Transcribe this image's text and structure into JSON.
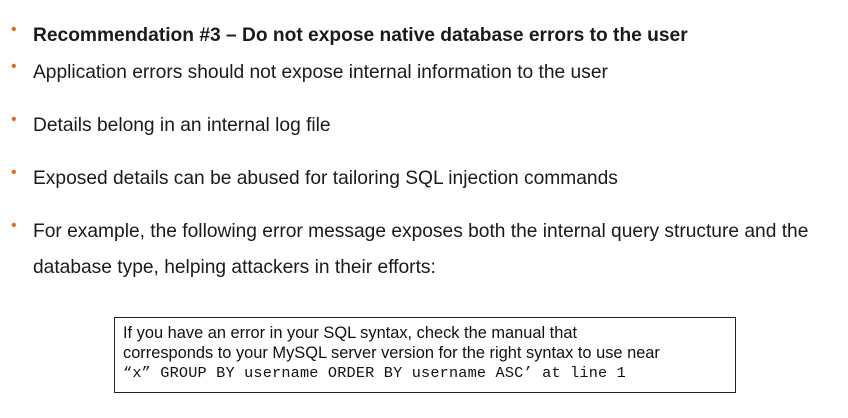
{
  "slide": {
    "bullet_color": "#e06a1b",
    "bullets": [
      {
        "marker": "•",
        "text": "Recommendation #3 – Do not expose native database errors to the user"
      },
      {
        "marker": "•",
        "text": "Application errors should not expose internal information to the user"
      },
      {
        "marker": "•",
        "text": "Details belong in an internal log file"
      },
      {
        "marker": "•",
        "text": "Exposed details can be abused for tailoring SQL injection commands"
      },
      {
        "marker": "•",
        "text": "For example, the following error message exposes both the internal query structure and the database type, helping attackers in their efforts:"
      }
    ],
    "error_box": {
      "line1": "If you have an error in your SQL syntax, check the manual that",
      "line2": "corresponds to your MySQL server version for the right syntax to use near",
      "line3": "“x” GROUP BY username ORDER BY username ASC’ at line 1"
    }
  }
}
